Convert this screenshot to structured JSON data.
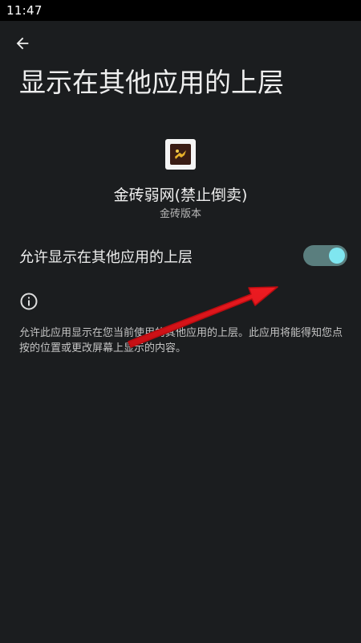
{
  "status_bar": {
    "time": "11:47"
  },
  "header": {
    "back_icon": "arrow-left-icon",
    "title": "显示在其他应用的上层"
  },
  "app": {
    "icon": "app-logo-icon",
    "name": "金砖弱网(禁止倒卖)",
    "version": "金砖版本"
  },
  "setting": {
    "label": "允许显示在其他应用的上层",
    "enabled": true,
    "track_color": "#5a7e7e",
    "thumb_color": "#7fe6f0"
  },
  "info": {
    "icon": "info-icon",
    "description": "允许此应用显示在您当前使用的其他应用的上层。此应用将能得知您点按的位置或更改屏幕上显示的内容。"
  },
  "annotation": {
    "arrow_color": "#e8141b"
  }
}
